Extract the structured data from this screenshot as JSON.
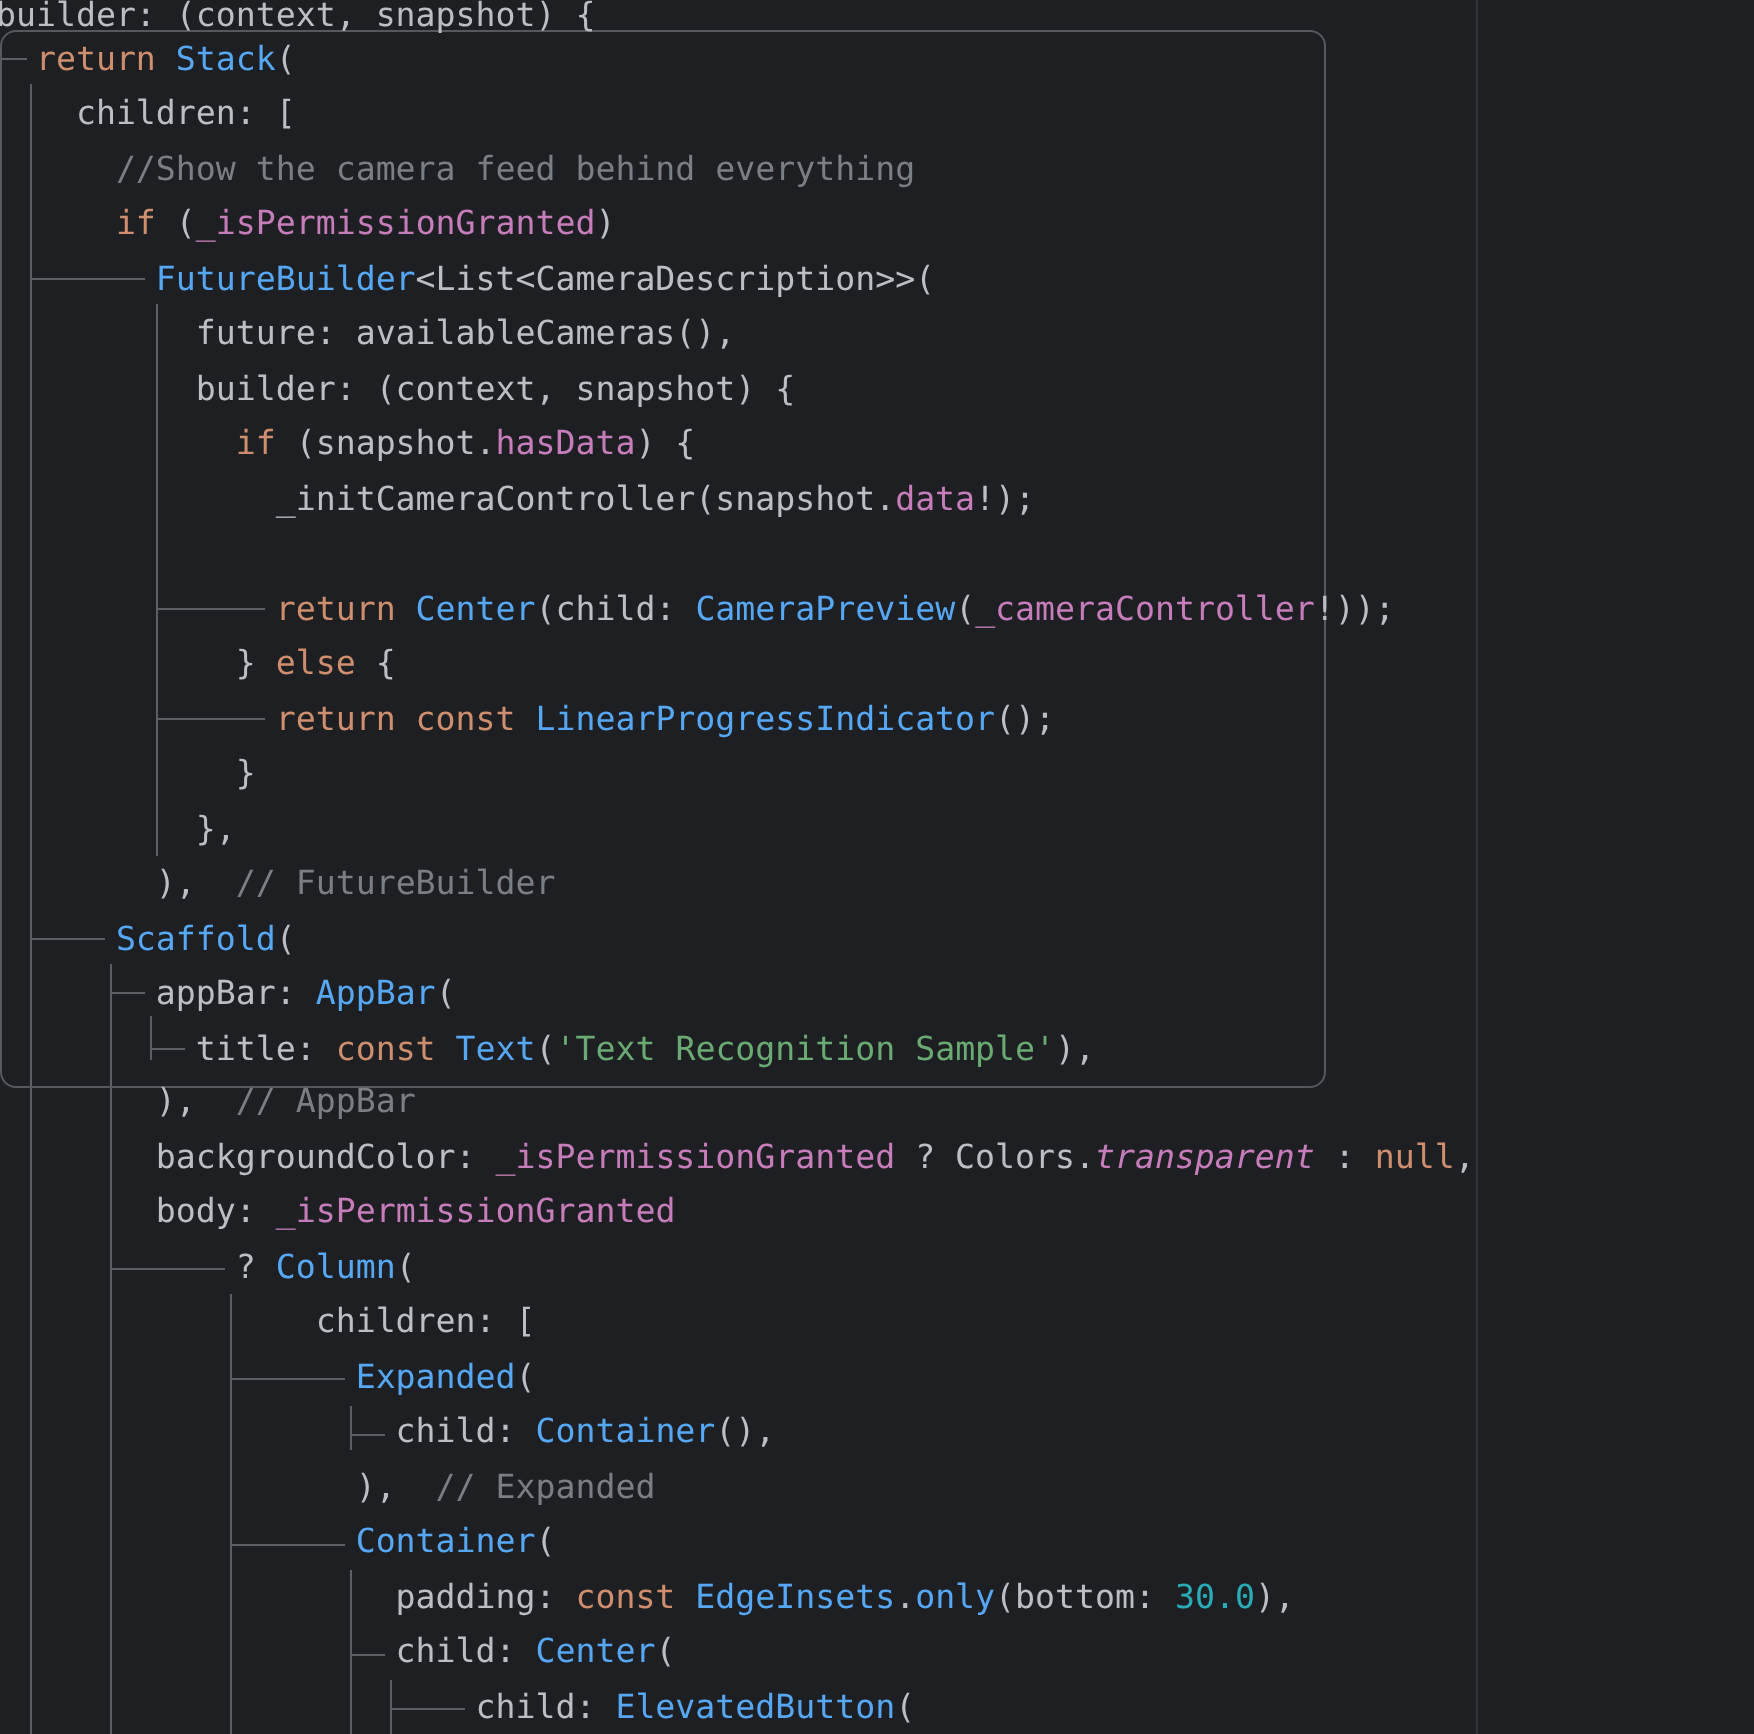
{
  "editor": {
    "lines_before": [
      {
        "tokens": [
          {
            "kind": "plain",
            "text": "builder: (context, snapshot) {"
          }
        ]
      }
    ],
    "popup": {
      "lines": [
        {
          "tokens": [
            {
              "kind": "keyword",
              "text": "  return "
            },
            {
              "kind": "type",
              "text": "Stack"
            },
            {
              "kind": "plain",
              "text": "("
            }
          ]
        },
        {
          "tokens": [
            {
              "kind": "plain",
              "text": "    children: ["
            }
          ]
        },
        {
          "tokens": [
            {
              "kind": "comment",
              "text": "      //Show the camera feed behind everything"
            }
          ]
        },
        {
          "tokens": [
            {
              "kind": "keyword",
              "text": "      if "
            },
            {
              "kind": "plain",
              "text": "("
            },
            {
              "kind": "field",
              "text": "_isPermissionGranted"
            },
            {
              "kind": "plain",
              "text": ")"
            }
          ]
        },
        {
          "tokens": [
            {
              "kind": "type",
              "text": "        FutureBuilder"
            },
            {
              "kind": "plain",
              "text": "<List<CameraDescription>>("
            }
          ]
        },
        {
          "tokens": [
            {
              "kind": "plain",
              "text": "          future: availableCameras(),"
            }
          ]
        },
        {
          "tokens": [
            {
              "kind": "plain",
              "text": "          builder: (context, snapshot) {"
            }
          ]
        },
        {
          "tokens": [
            {
              "kind": "keyword",
              "text": "            if "
            },
            {
              "kind": "plain",
              "text": "(snapshot."
            },
            {
              "kind": "field",
              "text": "hasData"
            },
            {
              "kind": "plain",
              "text": ") {"
            }
          ]
        },
        {
          "tokens": [
            {
              "kind": "plain",
              "text": "              _initCameraController(snapshot."
            },
            {
              "kind": "field",
              "text": "data"
            },
            {
              "kind": "plain",
              "text": "!);"
            }
          ]
        },
        {
          "blank_before": true,
          "tokens": [
            {
              "kind": "keyword",
              "text": "              return "
            },
            {
              "kind": "type",
              "text": "Center"
            },
            {
              "kind": "plain",
              "text": "(child: "
            },
            {
              "kind": "type",
              "text": "CameraPreview"
            },
            {
              "kind": "plain",
              "text": "("
            },
            {
              "kind": "field",
              "text": "_cameraController"
            },
            {
              "kind": "plain",
              "text": "!));"
            }
          ]
        },
        {
          "tokens": [
            {
              "kind": "plain",
              "text": "            } "
            },
            {
              "kind": "keyword",
              "text": "else "
            },
            {
              "kind": "plain",
              "text": "{"
            }
          ]
        },
        {
          "tokens": [
            {
              "kind": "keyword",
              "text": "              return const "
            },
            {
              "kind": "type",
              "text": "LinearProgressIndicator"
            },
            {
              "kind": "plain",
              "text": "();"
            }
          ]
        },
        {
          "tokens": [
            {
              "kind": "plain",
              "text": "            }"
            }
          ]
        },
        {
          "tokens": [
            {
              "kind": "plain",
              "text": "          },"
            }
          ]
        },
        {
          "tokens": [
            {
              "kind": "plain",
              "text": "        ),  "
            },
            {
              "kind": "comment",
              "text": "// FutureBuilder"
            }
          ]
        },
        {
          "tokens": [
            {
              "kind": "type",
              "text": "      Scaffold"
            },
            {
              "kind": "plain",
              "text": "("
            }
          ]
        },
        {
          "tokens": [
            {
              "kind": "plain",
              "text": "        appBar: "
            },
            {
              "kind": "type",
              "text": "AppBar"
            },
            {
              "kind": "plain",
              "text": "("
            }
          ]
        },
        {
          "tokens": [
            {
              "kind": "plain",
              "text": "          title: "
            },
            {
              "kind": "keyword",
              "text": "const "
            },
            {
              "kind": "type",
              "text": "Text"
            },
            {
              "kind": "plain",
              "text": "("
            },
            {
              "kind": "string",
              "text": "'Text Recognition Sample'"
            },
            {
              "kind": "plain",
              "text": "),"
            }
          ]
        }
      ]
    },
    "lines_after": [
      {
        "tokens": [
          {
            "kind": "plain",
            "text": "        ),  "
          },
          {
            "kind": "comment",
            "text": "// AppBar"
          }
        ]
      },
      {
        "tokens": [
          {
            "kind": "plain",
            "text": "        backgroundColor: "
          },
          {
            "kind": "field",
            "text": "_isPermissionGranted"
          },
          {
            "kind": "plain",
            "text": " ? Colors."
          },
          {
            "kind": "static",
            "text": "transparent"
          },
          {
            "kind": "plain",
            "text": " : "
          },
          {
            "kind": "keyword",
            "text": "null"
          },
          {
            "kind": "plain",
            "text": ","
          }
        ]
      },
      {
        "tokens": [
          {
            "kind": "plain",
            "text": "        body: "
          },
          {
            "kind": "field",
            "text": "_isPermissionGranted"
          }
        ]
      },
      {
        "tokens": [
          {
            "kind": "plain",
            "text": "            ? "
          },
          {
            "kind": "type",
            "text": "Column"
          },
          {
            "kind": "plain",
            "text": "("
          }
        ]
      },
      {
        "tokens": [
          {
            "kind": "plain",
            "text": "                children: ["
          }
        ]
      },
      {
        "tokens": [
          {
            "kind": "type",
            "text": "                  Expanded"
          },
          {
            "kind": "plain",
            "text": "("
          }
        ]
      },
      {
        "tokens": [
          {
            "kind": "plain",
            "text": "                    child: "
          },
          {
            "kind": "type",
            "text": "Container"
          },
          {
            "kind": "plain",
            "text": "(),"
          }
        ]
      },
      {
        "tokens": [
          {
            "kind": "plain",
            "text": "                  ),  "
          },
          {
            "kind": "comment",
            "text": "// Expanded"
          }
        ]
      },
      {
        "tokens": [
          {
            "kind": "type",
            "text": "                  Container"
          },
          {
            "kind": "plain",
            "text": "("
          }
        ]
      },
      {
        "tokens": [
          {
            "kind": "plain",
            "text": "                    padding: "
          },
          {
            "kind": "keyword",
            "text": "const "
          },
          {
            "kind": "type",
            "text": "EdgeInsets"
          },
          {
            "kind": "plain",
            "text": "."
          },
          {
            "kind": "type",
            "text": "only"
          },
          {
            "kind": "plain",
            "text": "(bottom: "
          },
          {
            "kind": "number",
            "text": "30.0"
          },
          {
            "kind": "plain",
            "text": "),"
          }
        ]
      },
      {
        "tokens": [
          {
            "kind": "plain",
            "text": "                    child: "
          },
          {
            "kind": "type",
            "text": "Center"
          },
          {
            "kind": "plain",
            "text": "("
          }
        ]
      },
      {
        "tokens": [
          {
            "kind": "plain",
            "text": "                        child: "
          },
          {
            "kind": "type",
            "text": "ElevatedButton"
          },
          {
            "kind": "plain",
            "text": "("
          }
        ]
      }
    ]
  }
}
